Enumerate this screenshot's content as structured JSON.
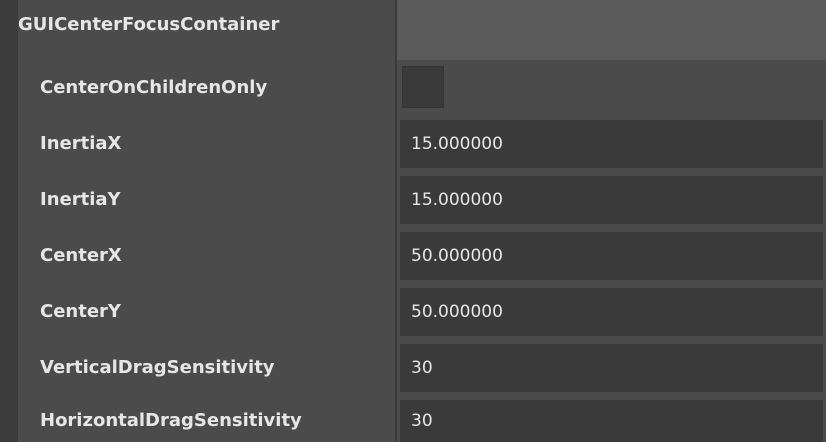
{
  "section": {
    "title": "GUICenterFocusContainer",
    "expanded_glyph": "▼"
  },
  "properties": [
    {
      "label": "CenterOnChildrenOnly",
      "type": "checkbox",
      "checked": false
    },
    {
      "label": "InertiaX",
      "type": "text",
      "value": "15.000000"
    },
    {
      "label": "InertiaY",
      "type": "text",
      "value": "15.000000"
    },
    {
      "label": "CenterX",
      "type": "text",
      "value": "50.000000"
    },
    {
      "label": "CenterY",
      "type": "text",
      "value": "50.000000"
    },
    {
      "label": "VerticalDragSensitivity",
      "type": "text",
      "value": "30"
    },
    {
      "label": "HorizontalDragSensitivity",
      "type": "text",
      "value": "30"
    }
  ],
  "colors": {
    "panel_bg": "#4b4b4b",
    "gutter_bg": "#3c3c3c",
    "field_bg": "#3a3a3a",
    "text": "#e6e6e6"
  }
}
